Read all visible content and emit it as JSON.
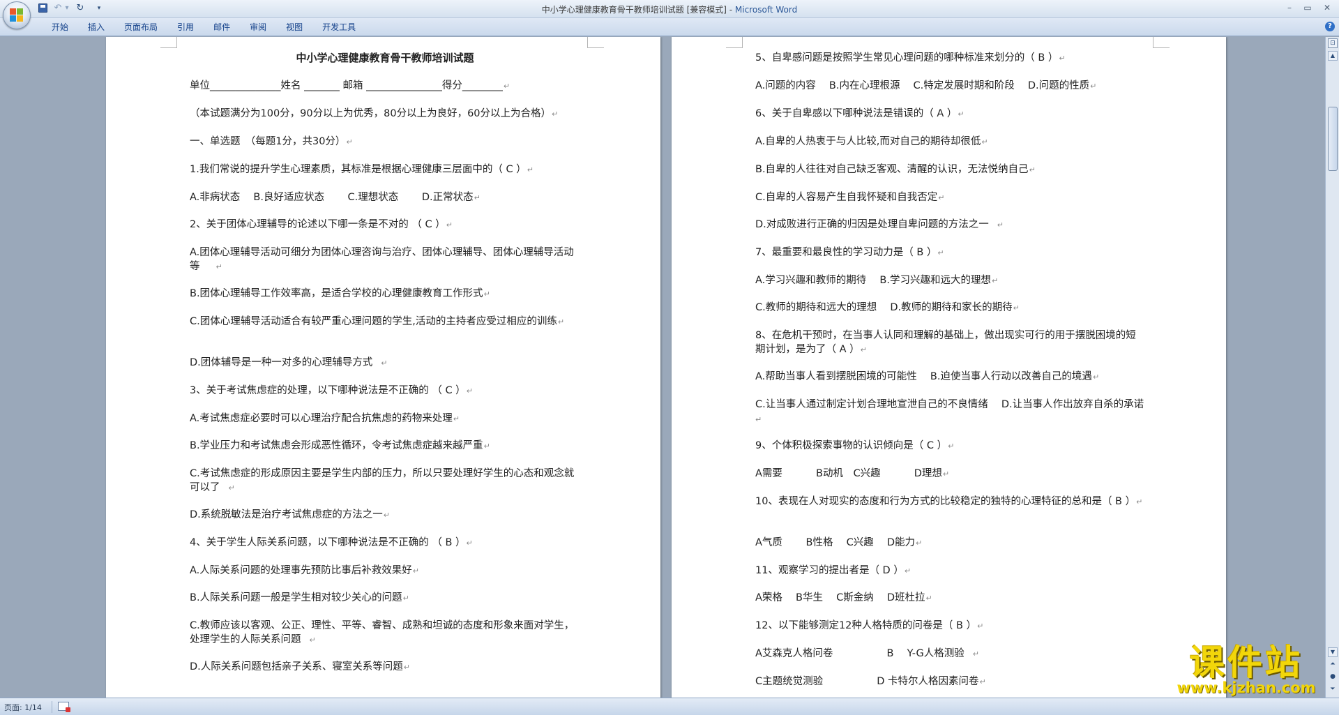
{
  "window": {
    "title_doc": "中小学心理健康教育骨干教师培训试题 [兼容模式] - ",
    "title_app": "Microsoft Word"
  },
  "ribbon": {
    "tabs": [
      "开始",
      "插入",
      "页面布局",
      "引用",
      "邮件",
      "审阅",
      "视图",
      "开发工具"
    ]
  },
  "status": {
    "page_indicator": "页面: 1/14"
  },
  "watermark": {
    "main": "课件站",
    "sub": "www.kjzhan.com"
  },
  "left_page": [
    "中小学心理健康教育骨干教师培训试题",
    "单位______________姓名 _______ 邮箱 _______________得分________",
    "（本试题满分为100分，90分以上为优秀，80分以上为良好，60分以上为合格）",
    "一、单选题　（每题1分，共30分）",
    "1.我们常说的提升学生心理素质，其标准是根据心理健康三层面中的（ C ）",
    "A.非病状态　 B.良好适应状态　　 C.理想状态　　 D.正常状态",
    "2、关于团体心理辅导的论述以下哪一条是不对的 （ C ）",
    "A.团体心理辅导活动可细分为团体心理咨询与治疗、团体心理辅导、团体心理辅导活动等",
    "B.团体心理辅导工作效率高，是适合学校的心理健康教育工作形式",
    "C.团体心理辅导活动适合有较严重心理问题的学生,活动的主持者应受过相应的训练",
    "D.团体辅导是一种一对多的心理辅导方式",
    "3、关于考试焦虑症的处理，以下哪种说法是不正确的 （ C ）",
    "A.考试焦虑症必要时可以心理治疗配合抗焦虑的药物来处理",
    "B.学业压力和考试焦虑会形成恶性循环，令考试焦虑症越来越严重",
    "C.考试焦虑症的形成原因主要是学生内部的压力，所以只要处理好学生的心态和观念就可以了",
    "D.系统脱敏法是治疗考试焦虑症的方法之一",
    "4、关于学生人际关系问题，以下哪种说法是不正确的 （ B ）",
    "A.人际关系问题的处理事先预防比事后补救效果好",
    "B.人际关系问题一般是学生相对较少关心的问题",
    "C.教师应该以客观、公正、理性、平等、睿智、成熟和坦诚的态度和形象来面对学生，处理学生的人际关系问题",
    "D.人际关系问题包括亲子关系、寝室关系等问题"
  ],
  "right_page": [
    "5、自卑感问题是按照学生常见心理问题的哪种标准来划分的（ B ）",
    "A.问题的内容　 B.内在心理根源　 C.特定发展时期和阶段　 D.问题的性质",
    "6、关于自卑感以下哪种说法是错误的（ A ）",
    "A.自卑的人热衷于与人比较,而对自己的期待却很低",
    "B.自卑的人往往对自己缺乏客观、清醒的认识，无法悦纳自己",
    "C.自卑的人容易产生自我怀疑和自我否定",
    "D.对成败进行正确的归因是处理自卑问题的方法之一",
    "7、最重要和最良性的学习动力是（ B ）",
    "A.学习兴趣和教师的期待　 B.学习兴趣和远大的理想",
    "C.教师的期待和远大的理想　 D.教师的期待和家长的期待",
    "8、在危机干预时，在当事人认同和理解的基础上，做出现实可行的用于摆脱困境的短期计划，是为了（ A ）",
    "A.帮助当事人看到摆脱困境的可能性　 B.迫使当事人行动以改善自己的境遇",
    "C.让当事人通过制定计划合理地宣泄自己的不良情绪　 D.让当事人作出放弃自杀的承诺",
    "9、个体积极探索事物的认识倾向是（ C ）",
    "A需要　　　 B动机　C兴趣　　　 D理想",
    "10、表现在人对现实的态度和行为方式的比较稳定的独特的心理特征的总和是（ B ）",
    "A气质　　 B性格　 C兴趣　 D能力",
    "11、观察学习的提出者是（ D ）",
    "A荣格　 B华生　 C斯金纳　 D班杜拉",
    "12、以下能够测定12种人格特质的问卷是（ B ）",
    "A艾森克人格问卷　　　　　 B　 Y-G人格测验",
    "C主题统觉测验　　　　　 D 卡特尔人格因素问卷"
  ]
}
